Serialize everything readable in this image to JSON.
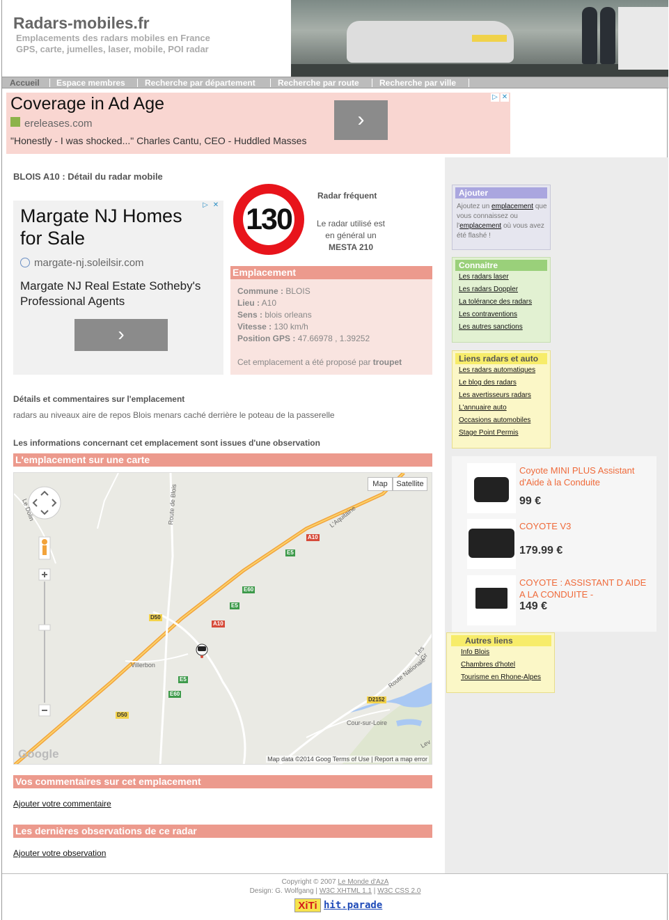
{
  "header": {
    "site_title": "Radars-mobiles.fr",
    "tagline1": "Emplacements des radars mobiles en France",
    "tagline2": "GPS, carte, jumelles, laser, mobile, POI radar"
  },
  "nav": {
    "items": [
      "Accueil",
      "Espace membres",
      "Recherche par département",
      "Recherche par route",
      "Recherche par ville"
    ]
  },
  "ad_top": {
    "headline": "Coverage in Ad Age",
    "domain": "ereleases.com",
    "quote": "\"Honestly - I was shocked...\" Charles Cantu, CEO - Huddled Masses",
    "go_icon": "›"
  },
  "page_heading": "BLOIS A10 : Détail du radar mobile",
  "ad_left": {
    "headline": "Margate NJ Homes for Sale",
    "domain": "margate-nj.soleilsir.com",
    "desc": "Margate NJ Real Estate Sotheby's Professional Agents",
    "go_icon": "›"
  },
  "radar": {
    "speed": "130",
    "frequency_label": "Radar fréquent",
    "used_line1": "Le radar utilisé est",
    "used_line2": "en général un",
    "used_model": "MESTA 210"
  },
  "emplacement": {
    "title": "Emplacement",
    "commune_label": "Commune :",
    "commune": "BLOIS",
    "lieu_label": "Lieu :",
    "lieu": "A10",
    "sens_label": "Sens :",
    "sens": "blois orleans",
    "vitesse_label": "Vitesse :",
    "vitesse": "130 km/h",
    "gps_label": "Position GPS :",
    "gps": "47.66978 , 1.39252",
    "proposed_text": "Cet emplacement a été proposé par",
    "proposed_by": "troupet"
  },
  "details": {
    "heading": "Détails et commentaires sur l'emplacement",
    "text": "radars au niveaux aire de repos Blois menars caché derrière le poteau de la passerelle",
    "observation_note": "Les informations concernant cet emplacement sont issues d'une observation"
  },
  "map_section": {
    "title": "L'emplacement sur une carte",
    "btn_map": "Map",
    "btn_satellite": "Satellite",
    "google": "Google",
    "footer": "Map data ©2014 Goog  Terms of Use  |  Report a map error",
    "labels": {
      "route_blois": "Route de Blois",
      "aquitaine": "L'Aquitaine",
      "villerbon": "Villerbon",
      "cour_sur_loire": "Cour-sur-Loire",
      "route_nationale": "Route Nationale",
      "le_dolin": "Le Dolin",
      "les_gr": "Les Gr",
      "lev": "Lev"
    },
    "badges": {
      "a10": "A10",
      "e5": "E5",
      "e60": "E60",
      "d50": "D50",
      "d2152": "D2152"
    }
  },
  "comments_section": {
    "title": "Vos commentaires sur cet emplacement",
    "add_link": "Ajouter votre commentaire"
  },
  "observations_section": {
    "title": "Les dernières observations de ce radar",
    "add_link": "Ajouter votre observation"
  },
  "sidebar": {
    "ajouter": {
      "title": "Ajouter",
      "t1": "Ajoutez un",
      "link1": "emplacement",
      "t2": "que vous connaissez ou l'",
      "link2": "emplacement",
      "t3": "où vous avez été flashé !"
    },
    "connaitre": {
      "title": "Connaitre",
      "links": [
        "Les radars laser",
        "Les radars Doppler",
        "La tolérance des radars",
        "Les contraventions",
        "Les autres sanctions"
      ]
    },
    "liens": {
      "title": "Liens radars et auto",
      "links": [
        "Les radars automatiques",
        "Le blog des radars",
        "Les avertisseurs radars",
        "L'annuaire auto",
        "Occasions automobiles",
        "Stage Point Permis"
      ]
    },
    "products": [
      {
        "name": "Coyote MINI PLUS Assistant d'Aide à la Conduite",
        "price": "99 €"
      },
      {
        "name": "COYOTE V3",
        "price": "179.99 €"
      },
      {
        "name": "COYOTE : ASSISTANT D AIDE A LA CONDUITE -",
        "price": "149 €"
      }
    ],
    "autres": {
      "title": "Autres liens",
      "links": [
        "Info Blois",
        "Chambres d'hotel",
        "Tourisme en Rhone-Alpes"
      ]
    }
  },
  "footer": {
    "copyright": "Copyright © 2007",
    "copyright_link": "Le Monde d'AzA",
    "design": "Design: G. Wolfgang |",
    "xhtml": "W3C XHTML 1.1",
    "sep": "|",
    "css": "W3C CSS 2.0",
    "xiti": "XiTi",
    "hitparade": "hit.parade"
  },
  "colors": {
    "section_bar": "#ec9a8d",
    "ajouter": "#aaa6df",
    "connaitre": "#9ad07a",
    "liens": "#f7ec6a",
    "product_name": "#ef6a3a"
  }
}
